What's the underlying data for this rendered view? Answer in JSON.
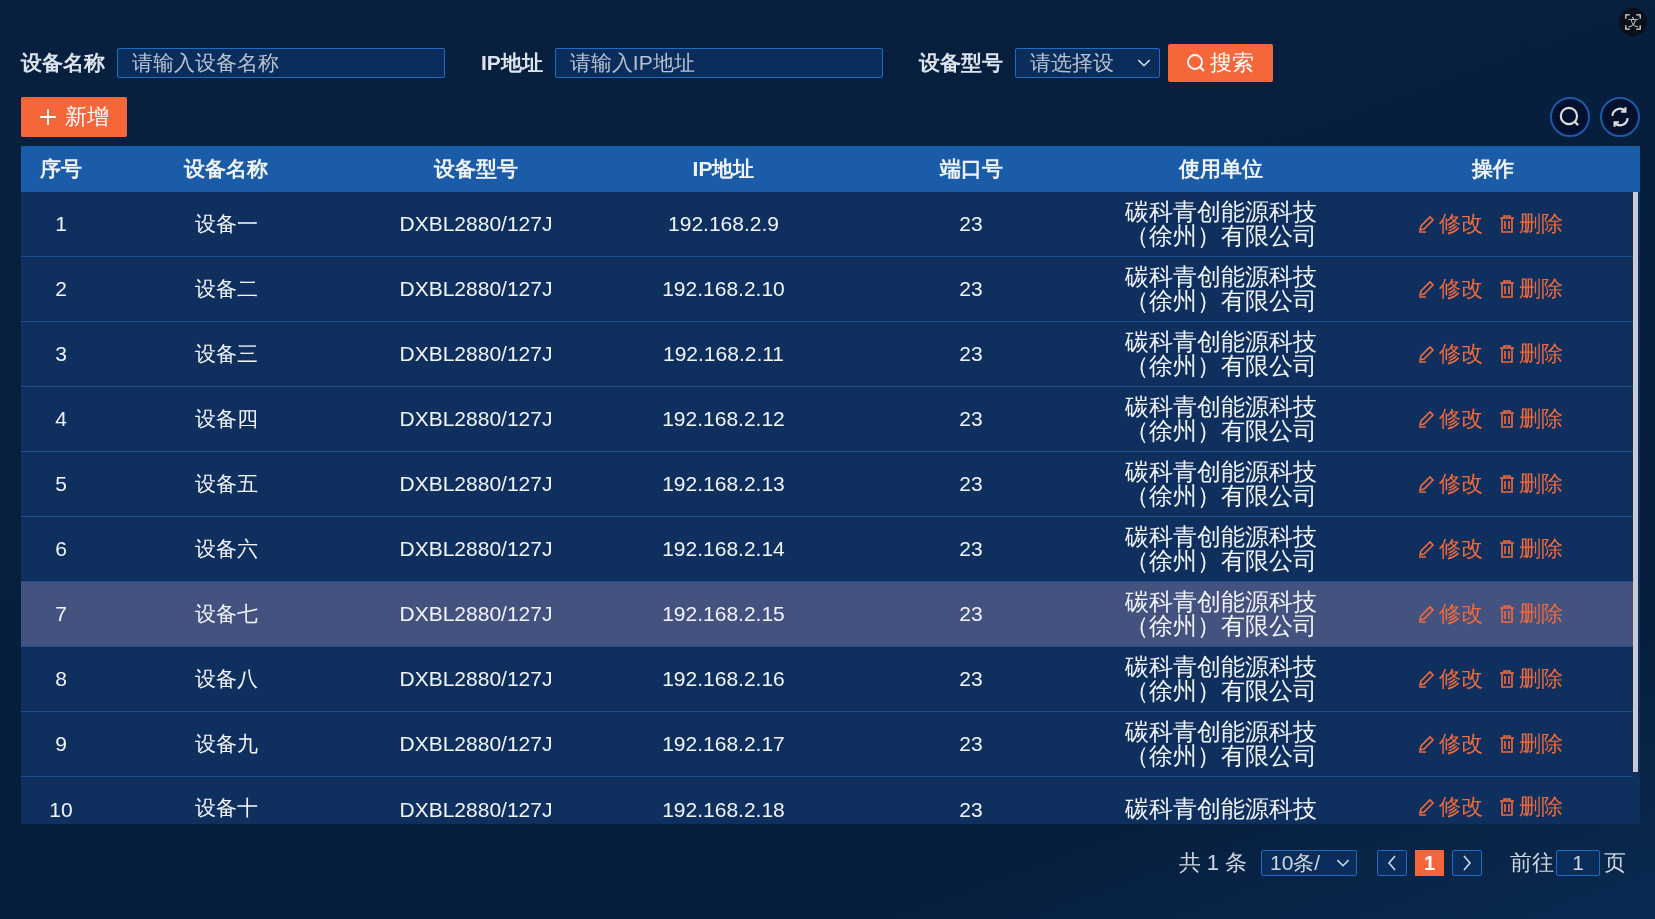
{
  "filters": [
    {
      "label": "设备名称",
      "kind": "input",
      "placeholder": "请输入设备名称"
    },
    {
      "label": "IP地址",
      "kind": "input",
      "placeholder": "请输入IP地址"
    },
    {
      "label": "设备型号",
      "kind": "select",
      "placeholder": "请选择设"
    }
  ],
  "search_button": "搜索",
  "add_button": "新增",
  "translate_badge": "文",
  "table": {
    "columns": [
      "序号",
      "设备名称",
      "设备型号",
      "IP地址",
      "端口号",
      "使用单位",
      "操作"
    ],
    "rows": [
      {
        "cells": [
          "1",
          "设备一",
          "DXBL2880/127J",
          "192.168.2.9",
          "23",
          [
            "碳科青创能源科技",
            "（徐州）有限公司"
          ]
        ],
        "actions": [
          "修改",
          "删除"
        ],
        "selected": false
      },
      {
        "cells": [
          "2",
          "设备二",
          "DXBL2880/127J",
          "192.168.2.10",
          "23",
          [
            "碳科青创能源科技",
            "（徐州）有限公司"
          ]
        ],
        "actions": [
          "修改",
          "删除"
        ],
        "selected": false
      },
      {
        "cells": [
          "3",
          "设备三",
          "DXBL2880/127J",
          "192.168.2.11",
          "23",
          [
            "碳科青创能源科技",
            "（徐州）有限公司"
          ]
        ],
        "actions": [
          "修改",
          "删除"
        ],
        "selected": false
      },
      {
        "cells": [
          "4",
          "设备四",
          "DXBL2880/127J",
          "192.168.2.12",
          "23",
          [
            "碳科青创能源科技",
            "（徐州）有限公司"
          ]
        ],
        "actions": [
          "修改",
          "删除"
        ],
        "selected": false
      },
      {
        "cells": [
          "5",
          "设备五",
          "DXBL2880/127J",
          "192.168.2.13",
          "23",
          [
            "碳科青创能源科技",
            "（徐州）有限公司"
          ]
        ],
        "actions": [
          "修改",
          "删除"
        ],
        "selected": false
      },
      {
        "cells": [
          "6",
          "设备六",
          "DXBL2880/127J",
          "192.168.2.14",
          "23",
          [
            "碳科青创能源科技",
            "（徐州）有限公司"
          ]
        ],
        "actions": [
          "修改",
          "删除"
        ],
        "selected": false
      },
      {
        "cells": [
          "7",
          "设备七",
          "DXBL2880/127J",
          "192.168.2.15",
          "23",
          [
            "碳科青创能源科技",
            "（徐州）有限公司"
          ]
        ],
        "actions": [
          "修改",
          "删除"
        ],
        "selected": true
      },
      {
        "cells": [
          "8",
          "设备八",
          "DXBL2880/127J",
          "192.168.2.16",
          "23",
          [
            "碳科青创能源科技",
            "（徐州）有限公司"
          ]
        ],
        "actions": [
          "修改",
          "删除"
        ],
        "selected": false
      },
      {
        "cells": [
          "9",
          "设备九",
          "DXBL2880/127J",
          "192.168.2.17",
          "23",
          [
            "碳科青创能源科技",
            "（徐州）有限公司"
          ]
        ],
        "actions": [
          "修改",
          "删除"
        ],
        "selected": false
      },
      {
        "cells": [
          "10",
          "设备十",
          "DXBL2880/127J",
          "192.168.2.18",
          "23",
          [
            "碳科青创能源科技"
          ]
        ],
        "actions": [
          "修改",
          "删除"
        ],
        "selected": false
      }
    ]
  },
  "pagination": {
    "total": "共 1 条",
    "page_size": "10条/",
    "pages": [
      {
        "label": "1",
        "selected": true
      }
    ],
    "goto_label": "前往",
    "goto_value": "1",
    "goto_suffix": "页"
  }
}
